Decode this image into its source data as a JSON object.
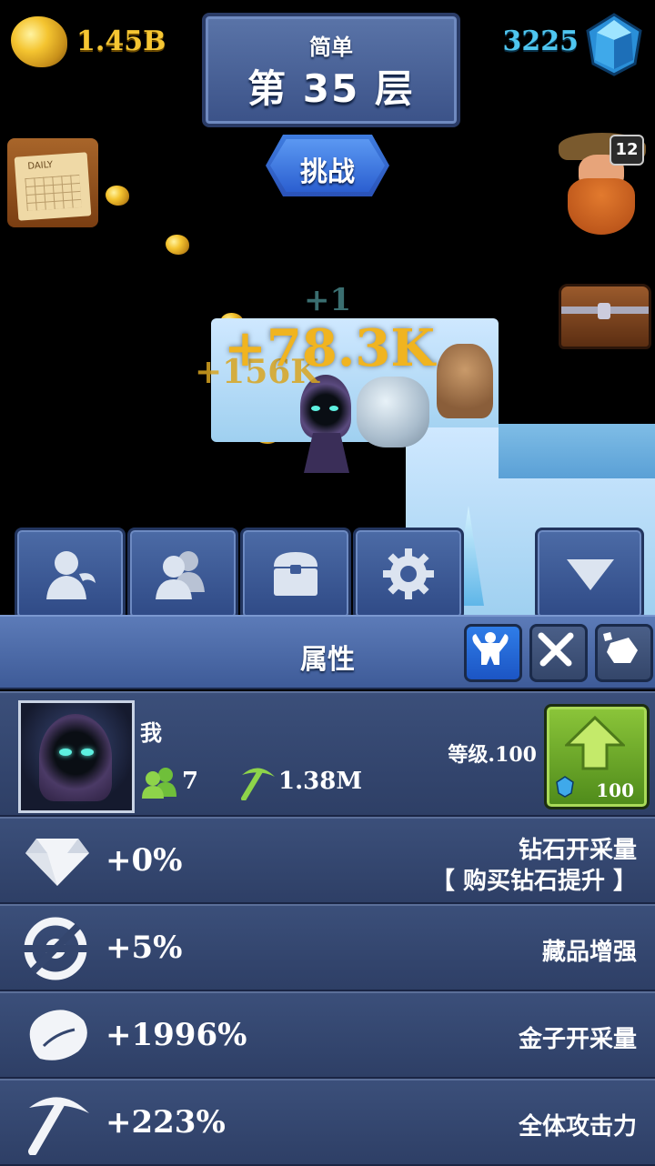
{
  "hud": {
    "gold": "1.45B",
    "gems": "3225",
    "difficulty": "简单",
    "floor": "第 35 层",
    "challenge": "挑战",
    "daily_label": "DAILY",
    "hero_level": "12"
  },
  "field": {
    "floating": [
      "+1",
      "+78.3K",
      "+156K"
    ]
  },
  "tabs": [
    "character-icon",
    "team-icon",
    "chest-icon",
    "gear-icon",
    "collapse-arrow-icon"
  ],
  "attributes": {
    "title": "属性"
  },
  "player": {
    "name": "我",
    "team_count": "7",
    "attack": "1.38M",
    "level": "等级.100",
    "upgrade_cost": "100"
  },
  "stats": [
    {
      "icon": "diamond-icon",
      "value": "+0%",
      "label": "钻石开采量",
      "sublabel": "【 购买钻石提升 】"
    },
    {
      "icon": "target-icon",
      "value": "+5%",
      "label": "藏品增强"
    },
    {
      "icon": "gold-nugget-icon",
      "value": "+1996%",
      "label": "金子开采量"
    },
    {
      "icon": "pickaxe-icon",
      "value": "+223%",
      "label": "全体攻击力"
    }
  ],
  "colors": {
    "gold": "#f6c633",
    "gem": "#4fc6f0",
    "accent": "#2f7de8",
    "upgrade": "#8cc63a"
  }
}
